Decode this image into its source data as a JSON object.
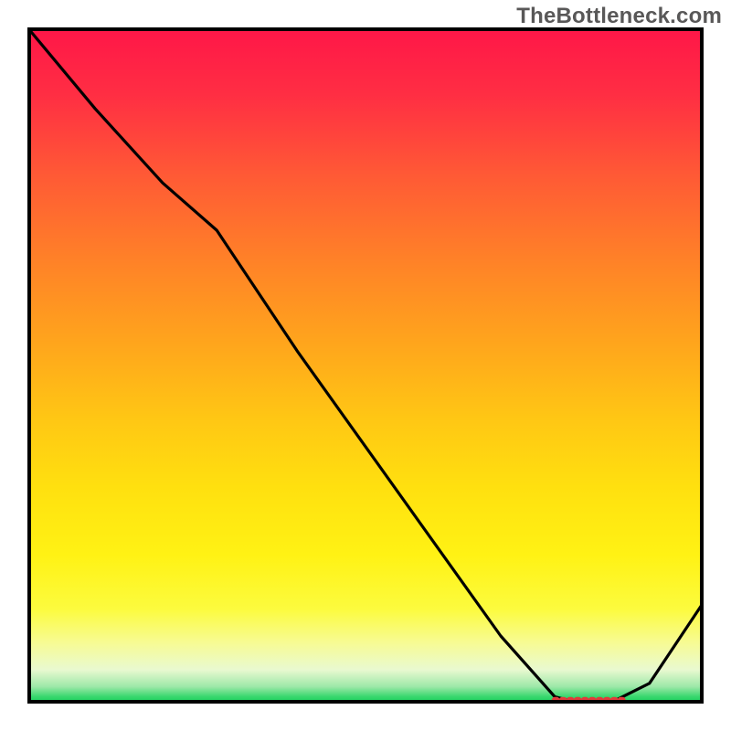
{
  "watermark": "TheBottleneck.com",
  "chart_data": {
    "type": "line",
    "title": "",
    "xlabel": "",
    "ylabel": "",
    "xlim": [
      0,
      100
    ],
    "ylim": [
      0,
      100
    ],
    "background": "gradient-red-yellow-green",
    "series": [
      {
        "name": "curve",
        "color": "#000000",
        "x": [
          0,
          10,
          20,
          28,
          40,
          50,
          60,
          70,
          78,
          82,
          86,
          92,
          100
        ],
        "y": [
          100,
          88,
          77,
          70,
          52,
          38,
          24,
          10,
          1,
          0,
          0,
          3,
          15
        ]
      }
    ],
    "annotations": [
      {
        "name": "optimal-range-marker",
        "type": "dashed-segment",
        "color": "#e03b3b",
        "x_start": 78,
        "x_end": 88,
        "y": 0.5
      }
    ],
    "grid": false,
    "legend": false
  }
}
